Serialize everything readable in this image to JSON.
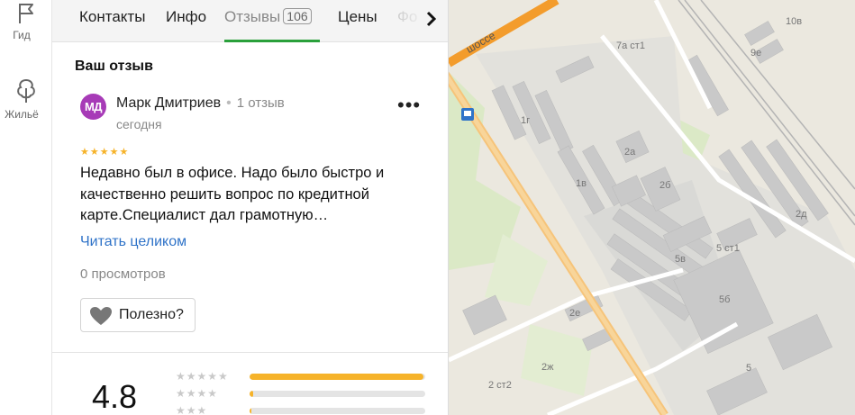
{
  "rail": {
    "guide_label": "Гид",
    "housing_label": "Жильё"
  },
  "tabs": {
    "contacts": "Контакты",
    "info": "Инфо",
    "reviews": "Отзывы",
    "reviews_count": "106",
    "prices": "Цены",
    "photos": "Фо"
  },
  "review": {
    "section_title": "Ваш отзыв",
    "avatar_initials": "МД",
    "author": "Марк Дмитриев",
    "author_reviews": "1 отзыв",
    "date": "сегодня",
    "stars": "★★★★★",
    "rating": 5,
    "text": "Недавно был в офисе. Надо было быстро и качественно решить вопрос по кредитной карте.Специалист дал грамотную…",
    "read_more": "Читать целиком",
    "views": "0 просмотров",
    "useful_label": "Полезно?"
  },
  "summary": {
    "score": "4.8",
    "rows": [
      {
        "stars": "★★★★★",
        "share": 0.99
      },
      {
        "stars": "★★★★",
        "share": 0.02
      },
      {
        "stars": "★★★",
        "share": 0.01
      }
    ]
  },
  "map": {
    "road_label": "шоссе",
    "labels": [
      "7а ст1",
      "10в",
      "9е",
      "1г",
      "2а",
      "1в",
      "2б",
      "2д",
      "5 ст1",
      "5в",
      "5б",
      "2е",
      "2ж",
      "2 ст2",
      "5"
    ]
  },
  "colors": {
    "accent_green": "#2aa03b",
    "link_blue": "#2f73c8",
    "star_yellow": "#f6b32a",
    "avatar_purple": "#a73bb7",
    "road_orange": "#f39c2c"
  }
}
